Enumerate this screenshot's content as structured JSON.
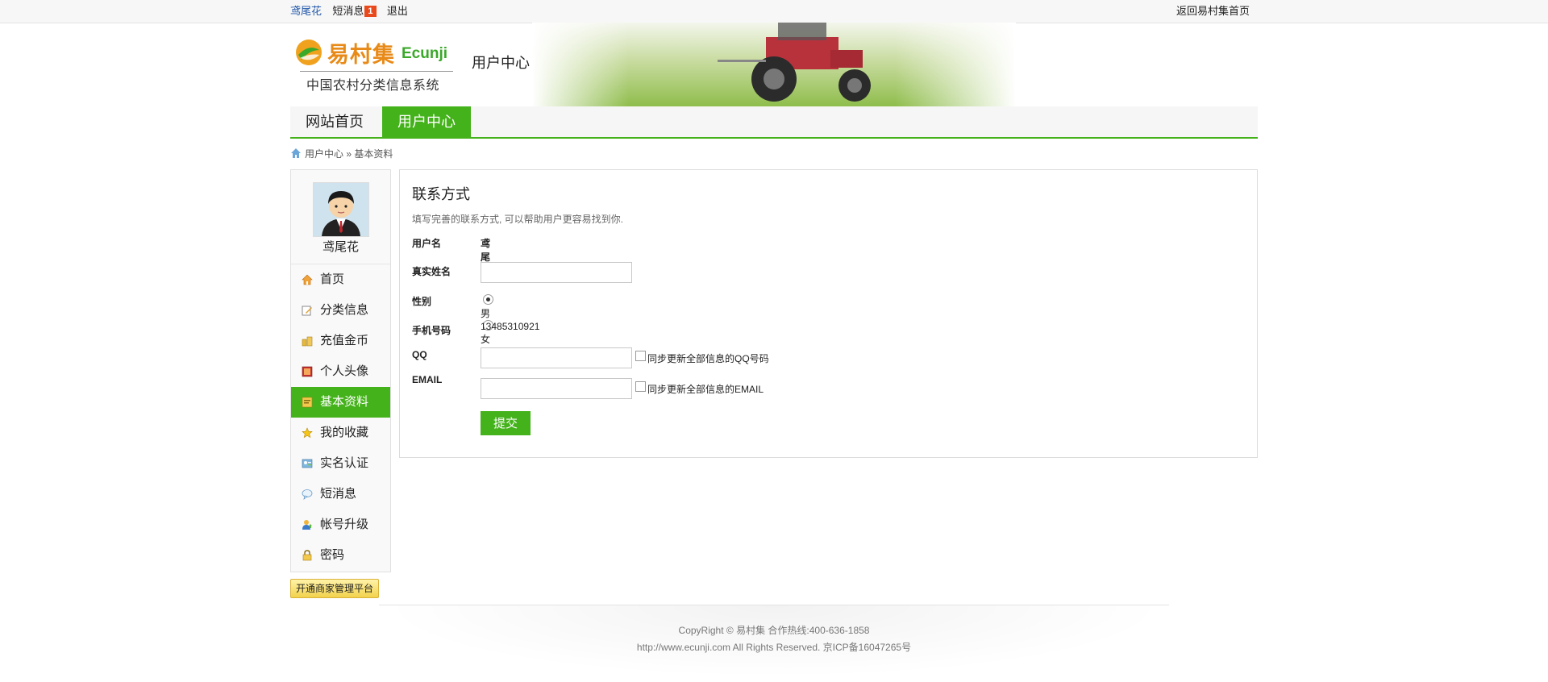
{
  "topbar": {
    "username": "鸢尾花",
    "messages_label": "短消息",
    "messages_count": "1",
    "logout": "退出",
    "back_home": "返回易村集首页"
  },
  "header": {
    "logo_cn": "易村集",
    "logo_en": "Ecunji",
    "logo_sub": "中国农村分类信息系统",
    "title": "用户中心"
  },
  "nav": {
    "home": "网站首页",
    "user_center": "用户中心"
  },
  "breadcrumb": {
    "root": "用户中心",
    "sep": " » ",
    "current": "基本资料"
  },
  "sidebar": {
    "username": "鸢尾花",
    "items": [
      {
        "label": "首页",
        "icon": "home-icon"
      },
      {
        "label": "分类信息",
        "icon": "edit-icon"
      },
      {
        "label": "充值金币",
        "icon": "coins-icon"
      },
      {
        "label": "个人头像",
        "icon": "picture-icon"
      },
      {
        "label": "基本资料",
        "icon": "profile-icon",
        "active": true
      },
      {
        "label": "我的收藏",
        "icon": "star-icon"
      },
      {
        "label": "实名认证",
        "icon": "id-card-icon"
      },
      {
        "label": "短消息",
        "icon": "chat-icon"
      },
      {
        "label": "帐号升级",
        "icon": "user-upgrade-icon"
      },
      {
        "label": "密码",
        "icon": "lock-icon"
      }
    ],
    "business_button": "开通商家管理平台"
  },
  "form": {
    "title": "联系方式",
    "description": "填写完善的联系方式, 可以帮助用户更容易找到你.",
    "username_label": "用户名",
    "username_value": "鸢尾花",
    "realname_label": "真实姓名",
    "realname_value": "",
    "gender_label": "性别",
    "gender_male": "男",
    "gender_female": "女",
    "gender_selected": "男",
    "phone_label": "手机号码",
    "phone_value": "13485310921",
    "qq_label": "QQ",
    "qq_value": "",
    "qq_sync_label": "同步更新全部信息的QQ号码",
    "email_label": "EMAIL",
    "email_value": "",
    "email_sync_label": "同步更新全部信息的EMAIL",
    "submit": "提交"
  },
  "footer": {
    "line1": "CopyRight © 易村集 合作热线:400-636-1858",
    "line2": "http://www.ecunji.com All Rights Reserved. 京ICP备16047265号"
  },
  "colors": {
    "accent_green": "#44b21a",
    "logo_orange": "#e88a17",
    "badge_red": "#e8491d",
    "link_blue": "#1f56a8"
  }
}
